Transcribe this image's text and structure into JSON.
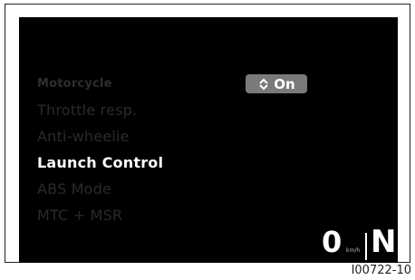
{
  "menu": {
    "header": "Motorcycle",
    "items": [
      {
        "label": "Throttle resp.",
        "selected": false
      },
      {
        "label": "Anti-wheelie",
        "selected": false
      },
      {
        "label": "Launch Control",
        "selected": true
      },
      {
        "label": "ABS Mode",
        "selected": false
      },
      {
        "label": "MTC + MSR",
        "selected": false
      }
    ]
  },
  "value": {
    "icon": "up-down-arrows-icon",
    "text": "On"
  },
  "status": {
    "speed": "0",
    "unit": "km/h",
    "gear": "N"
  },
  "figure": {
    "ref_code": "I00722-10"
  },
  "colors": {
    "background": "#000000",
    "selected_text": "#ffffff",
    "dim_text": "#2a2a2a",
    "pill": "#7a7a7a"
  }
}
